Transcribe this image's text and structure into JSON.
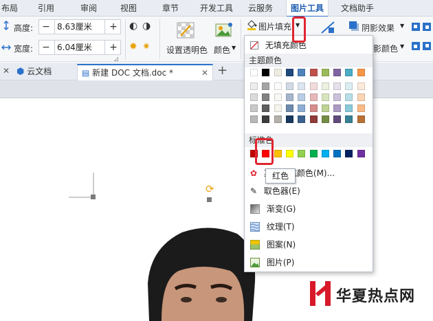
{
  "ribbon_tabs": [
    "布局",
    "引用",
    "审阅",
    "视图",
    "章节",
    "开发工具",
    "云服务",
    "图片工具",
    "文档助手"
  ],
  "ribbon": {
    "height_label": "高度:",
    "height_value": "8.63厘米",
    "width_label": "宽度:",
    "width_value": "6.04厘米",
    "set_transparent": "设置透明色",
    "color": "颜色",
    "picture_fill": "图片填充",
    "shadow_effect": "阴影效果",
    "shadow_color": "影颜色"
  },
  "doc_tabs": {
    "cloud": "云文档",
    "active_doc": "新建 DOC 文档.doc *",
    "new_tab": "+"
  },
  "dropdown": {
    "no_fill": "无填充颜色",
    "theme_colors": "主题颜色",
    "standard_colors": "标准色",
    "more_colors": "其他填充颜色(M)...",
    "eyedropper": "取色器(E)",
    "gradient": "渐变(G)",
    "texture": "纹理(T)",
    "pattern": "图案(N)",
    "picture": "图片(P)",
    "tooltip": "红色"
  },
  "colors": {
    "accent": "#2b71c9",
    "highlight": "#e0242f",
    "theme_top": [
      "#ffffff",
      "#000000",
      "#eeece1",
      "#1f497d",
      "#4f81bd",
      "#c0504d",
      "#9bbb59",
      "#8064a2",
      "#4bacc6",
      "#f79646"
    ],
    "standard": [
      "#c00000",
      "#ff0000",
      "#ffc000",
      "#ffff00",
      "#92d050",
      "#00b050",
      "#00b0f0",
      "#0070c0",
      "#002060",
      "#7030a0"
    ]
  },
  "watermark": {
    "text": "华夏热点网"
  }
}
